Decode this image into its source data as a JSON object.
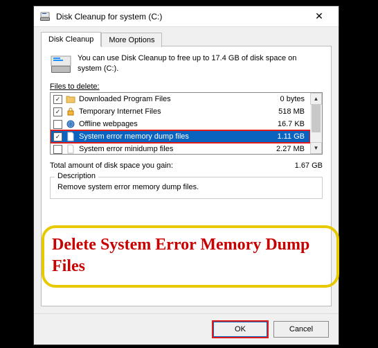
{
  "window": {
    "title": "Disk Cleanup for system (C:)"
  },
  "tabs": {
    "active": "Disk Cleanup",
    "other": "More Options"
  },
  "info": {
    "text": "You can use Disk Cleanup to free up to 17.4 GB of disk space on system (C:)."
  },
  "files_label": "Files to delete:",
  "files": [
    {
      "checked": true,
      "icon": "folder-icon",
      "name": "Downloaded Program Files",
      "size": "0 bytes",
      "selected": false
    },
    {
      "checked": true,
      "icon": "lock-icon",
      "name": "Temporary Internet Files",
      "size": "518 MB",
      "selected": false
    },
    {
      "checked": false,
      "icon": "globe-icon",
      "name": "Offline webpages",
      "size": "16.7 KB",
      "selected": false
    },
    {
      "checked": true,
      "icon": "file-icon",
      "name": "System error memory dump files",
      "size": "1.11 GB",
      "selected": true
    },
    {
      "checked": false,
      "icon": "file-icon",
      "name": "System error minidump files",
      "size": "2.27 MB",
      "selected": false
    }
  ],
  "total": {
    "label": "Total amount of disk space you gain:",
    "value": "1.67 GB"
  },
  "description": {
    "legend": "Description",
    "text": "Remove system error memory dump files."
  },
  "buttons": {
    "ok": "OK",
    "cancel": "Cancel"
  },
  "callout": {
    "text": "Delete System Error Memory Dump Files"
  }
}
